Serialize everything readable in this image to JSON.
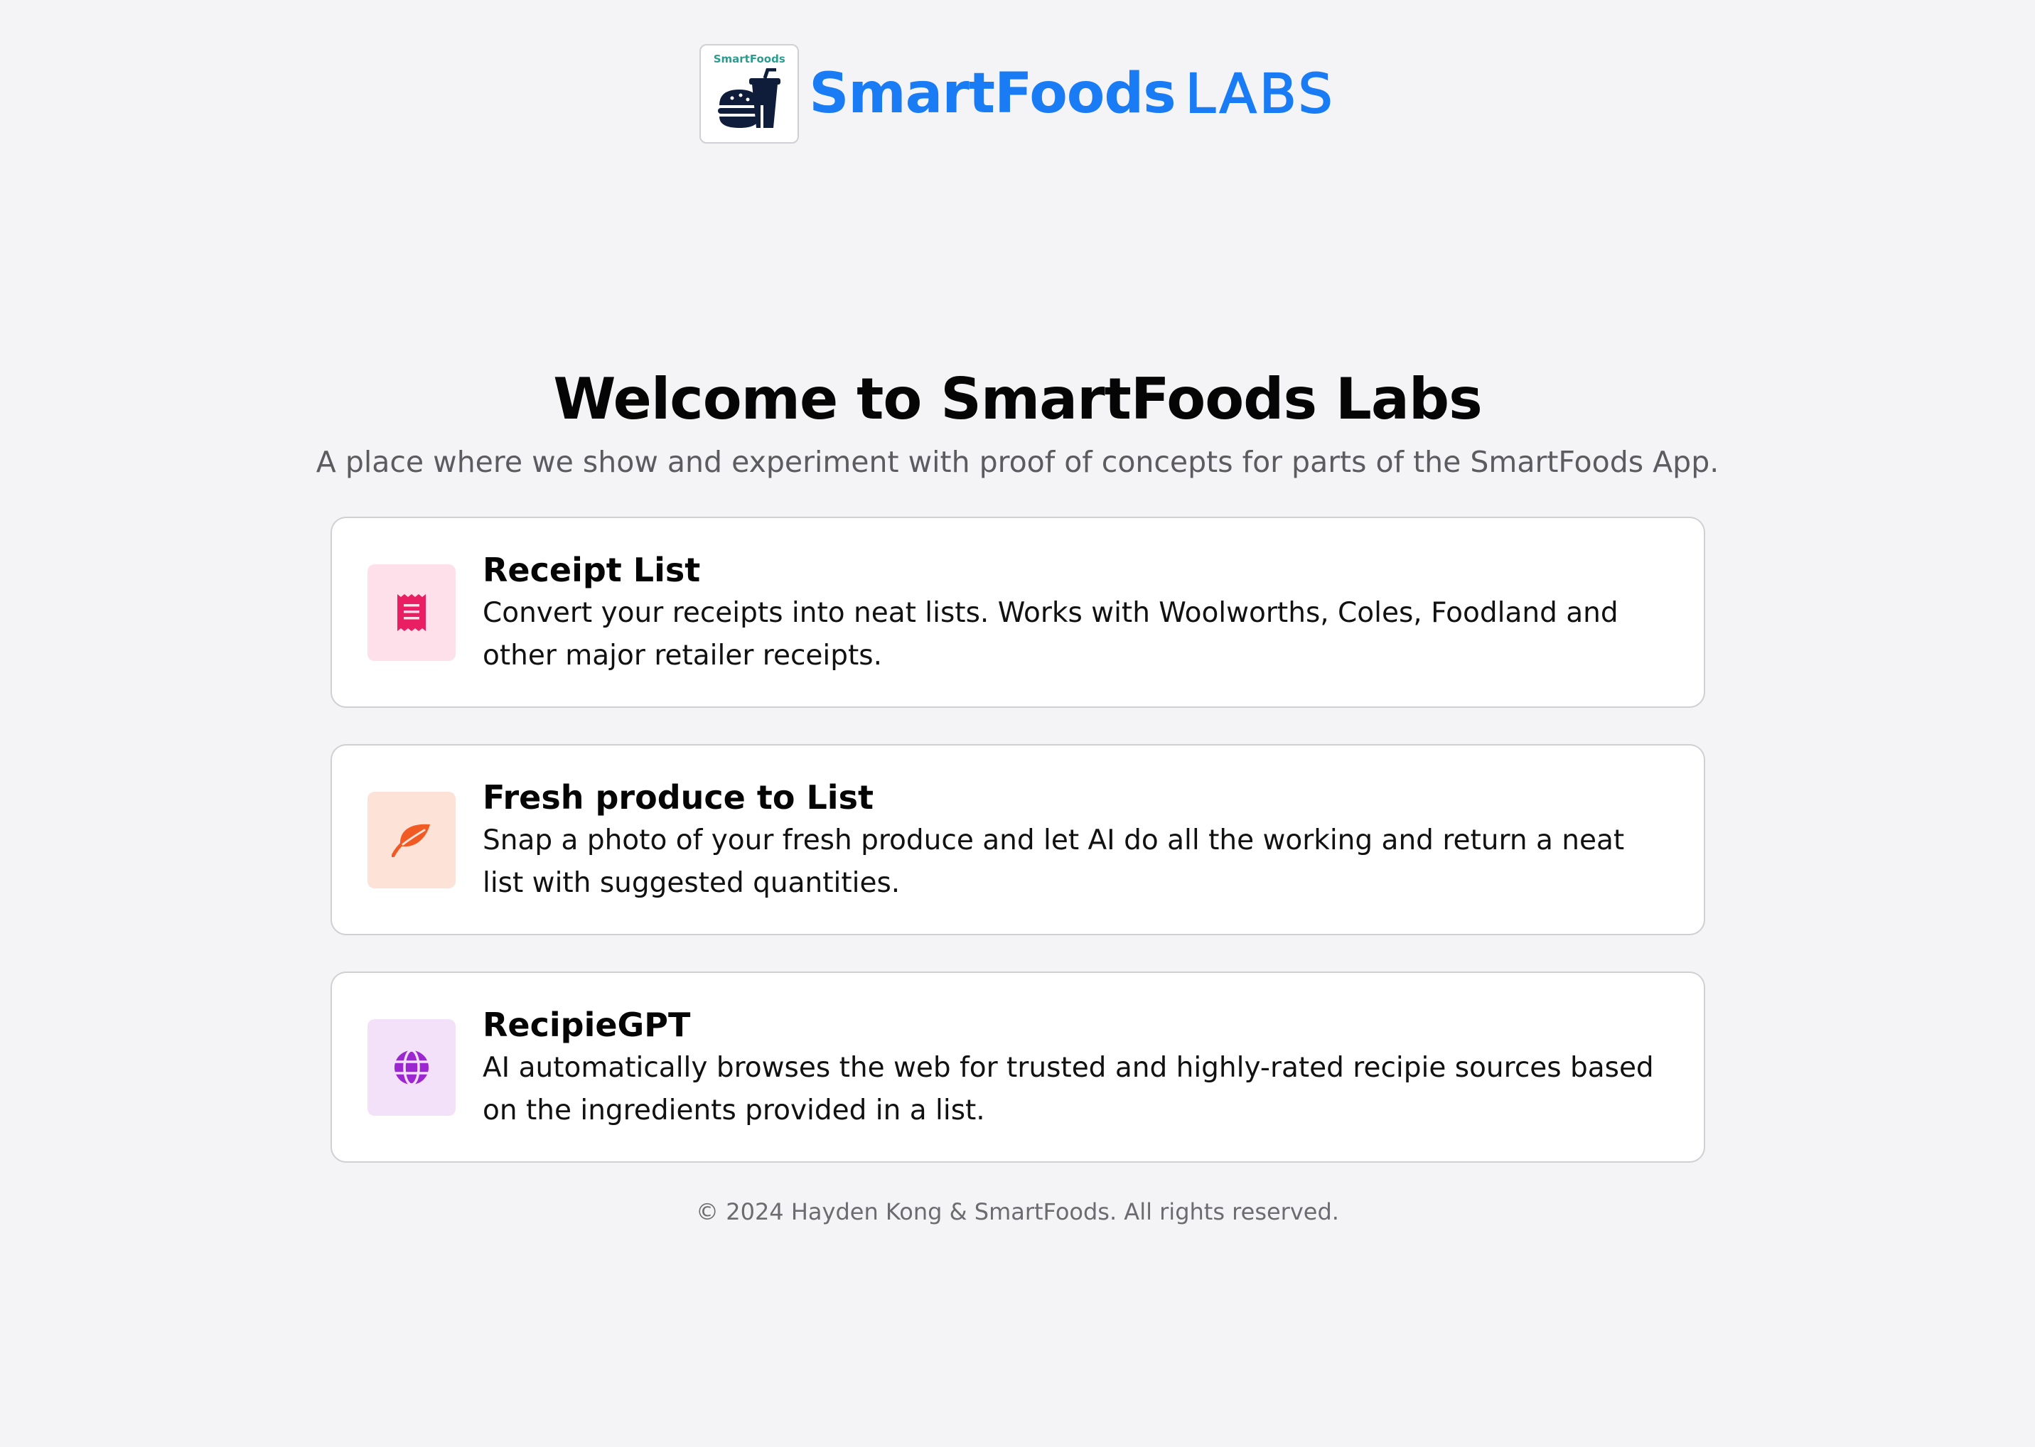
{
  "header": {
    "logo_text": "SmartFoods",
    "brand_name": "SmartFoods",
    "brand_suffix": "LABS"
  },
  "hero": {
    "title": "Welcome to SmartFoods Labs",
    "subtitle": "A place where we show and experiment with proof of concepts for parts of the SmartFoods App."
  },
  "cards": [
    {
      "title": "Receipt List",
      "description": "Convert your receipts into neat lists. Works with Woolworths, Coles, Foodland and other major retailer receipts.",
      "icon": "receipt-icon",
      "icon_color": "#e91e63",
      "icon_bg": "#fde0ea"
    },
    {
      "title": "Fresh produce to List",
      "description": "Snap a photo of your fresh produce and let AI do all the working and return a neat list with suggested quantities.",
      "icon": "leaf-icon",
      "icon_color": "#f15a22",
      "icon_bg": "#fde2d8"
    },
    {
      "title": "RecipieGPT",
      "description": "AI automatically browses the web for trusted and highly-rated recipie sources based on the ingredients provided in a list.",
      "icon": "globe-icon",
      "icon_color": "#9c27d0",
      "icon_bg": "#f3e1fa"
    }
  ],
  "footer": {
    "copyright": "© 2024 Hayden Kong & SmartFoods. All rights reserved."
  },
  "colors": {
    "brand": "#1a7cf5",
    "background": "#f4f4f7"
  }
}
